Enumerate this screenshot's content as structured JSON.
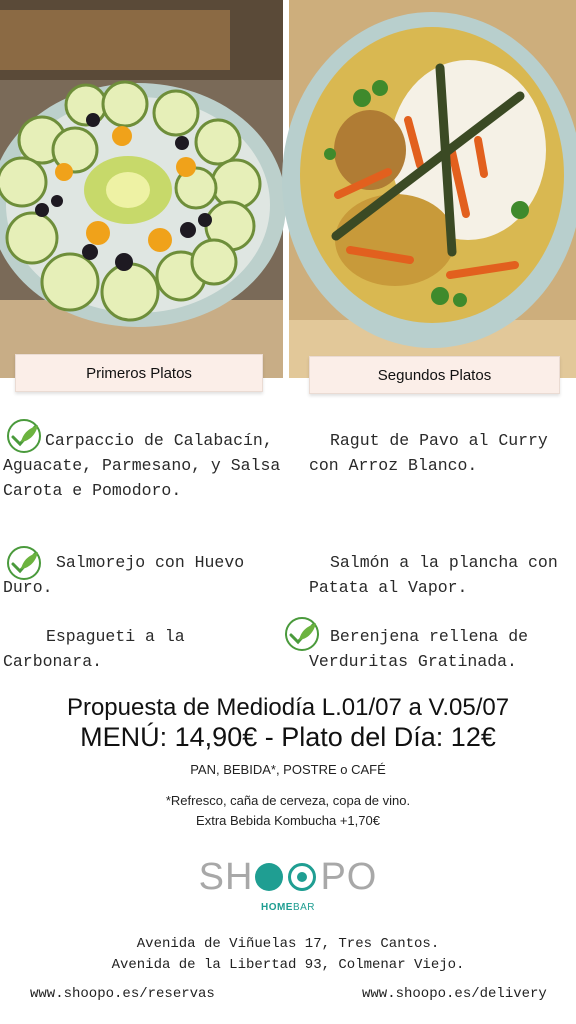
{
  "sections": {
    "first": "Primeros Platos",
    "second": "Segundos Platos"
  },
  "dishes": {
    "d1": [
      "Carpaccio de Calabacín,",
      "Aguacate, Parmesano, y Salsa",
      "Carota e Pomodoro."
    ],
    "d2": [
      "Ragut de Pavo al Curry",
      "con Arroz Blanco."
    ],
    "d3": [
      "Salmorejo con Huevo",
      "Duro."
    ],
    "d4": [
      "Salmón a la plancha con",
      "Patata al Vapor."
    ],
    "d5": [
      "Espagueti a la",
      "Carbonara."
    ],
    "d6": [
      "Berenjena rellena de",
      "Verduritas Gratinada."
    ]
  },
  "offer": {
    "line1": "Propuesta de Mediodía L.01/07 a V.05/07",
    "line2": "MENÚ: 14,90€ - Plato del Día: 12€",
    "includes": "PAN, BEBIDA*, POSTRE o CAFÉ",
    "note1": "*Refresco, caña de cerveza, copa de vino.",
    "note2": "Extra Bebida Kombucha +1,70€"
  },
  "brand": {
    "name_left": "SH",
    "name_right": "PO",
    "sub_bold": "HOME",
    "sub_light": "BAR",
    "color_gray": "#a8a8a8",
    "color_teal": "#1f9e92"
  },
  "footer": {
    "address1": "Avenida de Viñuelas 17, Tres Cantos.",
    "address2": "Avenida de la Libertad 93, Colmenar Viejo.",
    "link_left": "www.shoopo.es/reservas",
    "link_right": "www.shoopo.es/delivery"
  }
}
